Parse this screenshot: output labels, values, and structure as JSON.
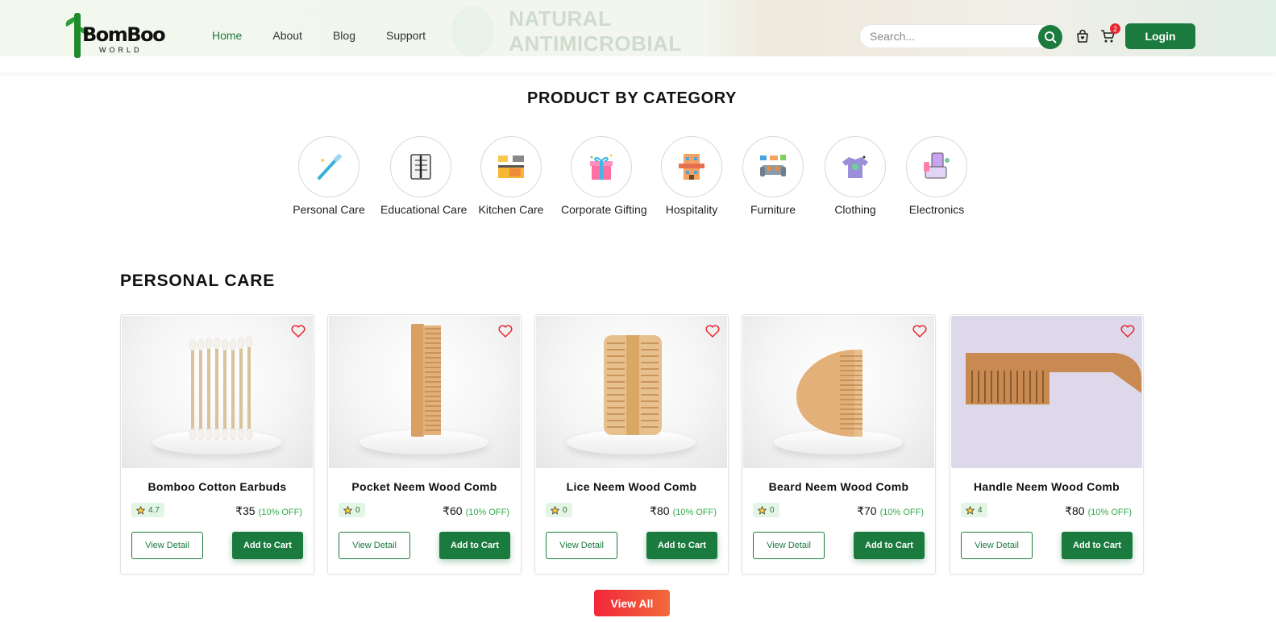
{
  "header": {
    "logo_text": "BomBoo",
    "logo_subtext": "WORLD",
    "banner_ghost_text": "NATURAL ANTIMICROBIAL",
    "nav": [
      {
        "label": "Home",
        "active": true
      },
      {
        "label": "About",
        "active": false
      },
      {
        "label": "Blog",
        "active": false
      },
      {
        "label": "Support",
        "active": false
      }
    ],
    "search_placeholder": "Search...",
    "cart_count": "2",
    "login_label": "Login"
  },
  "categories": {
    "title": "PRODUCT BY CATEGORY",
    "items": [
      {
        "label": "Personal Care",
        "icon": "toothbrush-icon"
      },
      {
        "label": "Educational Care",
        "icon": "notebook-pen-icon"
      },
      {
        "label": "Kitchen Care",
        "icon": "kitchen-icon"
      },
      {
        "label": "Corporate Gifting",
        "icon": "gift-icon"
      },
      {
        "label": "Hospitality",
        "icon": "hotel-icon"
      },
      {
        "label": "Furniture",
        "icon": "sofa-icon"
      },
      {
        "label": "Clothing",
        "icon": "shirt-icon"
      },
      {
        "label": "Electronics",
        "icon": "devices-icon"
      }
    ]
  },
  "section": {
    "title": "PERSONAL CARE",
    "products": [
      {
        "name": "Bomboo Cotton Earbuds",
        "rating": "4.7",
        "price": "₹35",
        "discount": "(10% OFF)",
        "view_label": "View Detail",
        "cart_label": "Add to Cart"
      },
      {
        "name": "Pocket Neem Wood Comb",
        "rating": "0",
        "price": "₹60",
        "discount": "(10% OFF)",
        "view_label": "View Detail",
        "cart_label": "Add to Cart"
      },
      {
        "name": "Lice Neem Wood Comb",
        "rating": "0",
        "price": "₹80",
        "discount": "(10% OFF)",
        "view_label": "View Detail",
        "cart_label": "Add to Cart"
      },
      {
        "name": "Beard Neem Wood Comb",
        "rating": "0",
        "price": "₹70",
        "discount": "(10% OFF)",
        "view_label": "View Detail",
        "cart_label": "Add to Cart"
      },
      {
        "name": "Handle Neem Wood Comb",
        "rating": "4",
        "price": "₹80",
        "discount": "(10% OFF)",
        "view_label": "View Detail",
        "cart_label": "Add to Cart"
      }
    ],
    "view_all_label": "View All"
  },
  "colors": {
    "brand_green": "#1b7a3e",
    "discount_green": "#2eae4b",
    "badge_red": "#e8262b",
    "view_all_gradient": [
      "#f2263a",
      "#f26a3a"
    ]
  }
}
